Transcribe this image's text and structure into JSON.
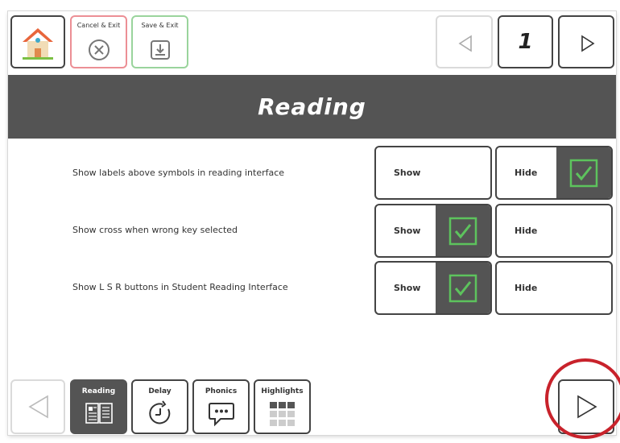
{
  "toolbar": {
    "cancel_label": "Cancel & Exit",
    "save_label": "Save & Exit",
    "page_number": "1"
  },
  "header": {
    "title": "Reading"
  },
  "settings": [
    {
      "label": "Show labels above symbols in reading interface",
      "show": "Show",
      "hide": "Hide",
      "selected": "hide"
    },
    {
      "label": "Show cross when wrong key selected",
      "show": "Show",
      "hide": "Hide",
      "selected": "show"
    },
    {
      "label": "Show L S R buttons in Student Reading Interface",
      "show": "Show",
      "hide": "Hide",
      "selected": "show"
    }
  ],
  "tabs": [
    {
      "label": "Reading",
      "active": true
    },
    {
      "label": "Delay",
      "active": false
    },
    {
      "label": "Phonics",
      "active": false
    },
    {
      "label": "Highlights",
      "active": false
    }
  ],
  "colors": {
    "accent_green": "#5dc35d",
    "dark_gray": "#545454",
    "cancel_border": "#ec8f95",
    "save_border": "#9ad49c",
    "annotation_red": "#c8222b"
  }
}
